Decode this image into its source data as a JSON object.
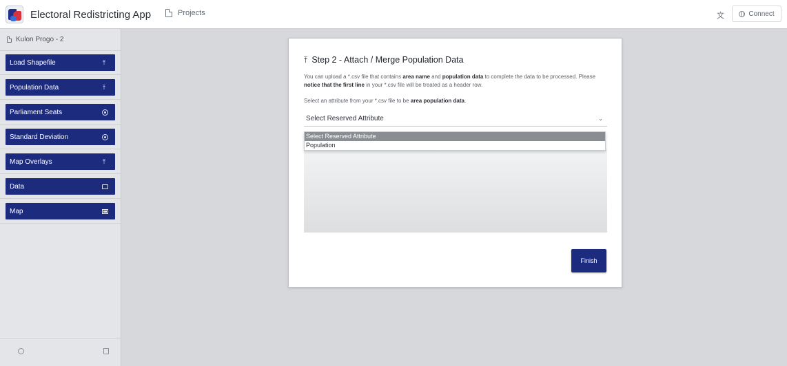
{
  "app": {
    "title": "Electoral Redistricting App",
    "projects_label": "Projects",
    "lang_label": "文",
    "connect_label": "Connect"
  },
  "sidebar": {
    "project_name": "Kulon Progo - 2",
    "items": [
      {
        "label": "Load Shapefile",
        "icon": "upload-icon"
      },
      {
        "label": "Population Data",
        "icon": "upload-icon"
      },
      {
        "label": "Parliament Seats",
        "icon": "circle-icon"
      },
      {
        "label": "Standard Deviation",
        "icon": "circle-icon"
      },
      {
        "label": "Map Overlays",
        "icon": "upload-icon"
      },
      {
        "label": "Data",
        "icon": "folder-icon"
      },
      {
        "label": "Map",
        "icon": "map-icon"
      }
    ]
  },
  "modal": {
    "title": "Step 2 - Attach / Merge Population Data",
    "desc_part1": "You can upload a *.csv file that contains ",
    "desc_bold1": "area name",
    "desc_part2": " and ",
    "desc_bold2": "population data",
    "desc_part3": " to complete the data to be processed. Please ",
    "desc_bold3": "notice that the first line",
    "desc_part4": " in your *.csv file will be treated as a header row.",
    "select_label_part1": "Select an attribute from your *.csv file to be ",
    "select_label_bold": "area population data",
    "select_label_part2": ".",
    "select_value": "Select Reserved Attribute",
    "dropdown_options": [
      "Select Reserved Attribute",
      "Population"
    ],
    "finish_label": "Finish"
  },
  "colors": {
    "primary": "#1c2b7e",
    "background": "#d6d8db"
  }
}
